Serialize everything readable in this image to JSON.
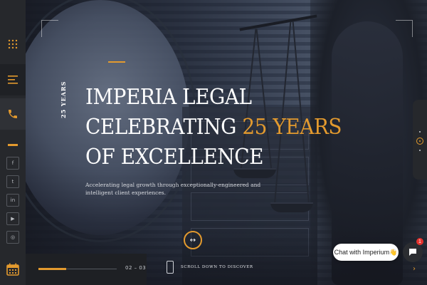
{
  "sidebar": {
    "social": [
      {
        "icon": "facebook-icon",
        "glyph": "f"
      },
      {
        "icon": "twitter-icon",
        "glyph": "t"
      },
      {
        "icon": "linkedin-icon",
        "glyph": "in"
      },
      {
        "icon": "youtube-icon",
        "glyph": "▶"
      },
      {
        "icon": "instagram-icon",
        "glyph": "◎"
      }
    ]
  },
  "hero": {
    "years_vertical": "25 YEARS",
    "headline_line1": "IMPERIA LEGAL",
    "headline_line2_prefix": "CELEBRATING ",
    "headline_line2_accent": "25 YEARS",
    "headline_line3": "OF EXCELLENCE",
    "tagline": "Accelerating legal growth through exceptionally-engineered and intelligent client experiences."
  },
  "slider": {
    "counter": "02 – 03",
    "progress": 0.35
  },
  "scroll": {
    "label": "SCROLL DOWN TO DISCOVER"
  },
  "chat": {
    "bubble_text": "Chat with Imperium👋",
    "badge_count": "1"
  },
  "colors": {
    "accent": "#e39a2e",
    "sidebar": "#26282c",
    "badge": "#e5322d"
  }
}
